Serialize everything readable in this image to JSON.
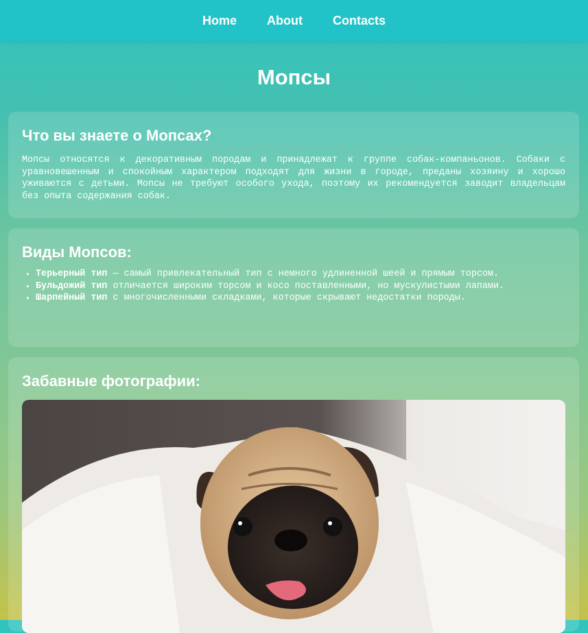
{
  "nav": {
    "items": [
      {
        "label": "Home"
      },
      {
        "label": "About"
      },
      {
        "label": "Contacts"
      }
    ]
  },
  "page": {
    "title": "Мопсы"
  },
  "about": {
    "heading": "Что вы знаете о Мопсах?",
    "text": "Мопсы относятся к декоративным породам и принадлежат к группе собак-компаньонов. Собаки с уравновешенным и спокойным характером подходят для жизни в городе, преданы хозяину и хорошо уживаются с детьми. Мопсы не требуют особого ухода, поэтому их рекомендуется заводит владельцам без опыта содержания собак."
  },
  "types": {
    "heading": "Виды Мопсов:",
    "items": [
      {
        "name": "Терьерный тип",
        "text": " — самый привлекательный тип с немного удлиненной шеей и прямым торсом."
      },
      {
        "name": "Бульдожий тип",
        "text": " отличается широким торсом и косо поставленными, но мускулистыми лапами."
      },
      {
        "name": "Шарпейный тип",
        "text": " с многочисленными складками, которые скрывают недостатки породы."
      }
    ]
  },
  "photos": {
    "heading": "Забавные фотографии:"
  },
  "colors": {
    "navbar": "#22c3c8",
    "text": "#ffffff"
  }
}
